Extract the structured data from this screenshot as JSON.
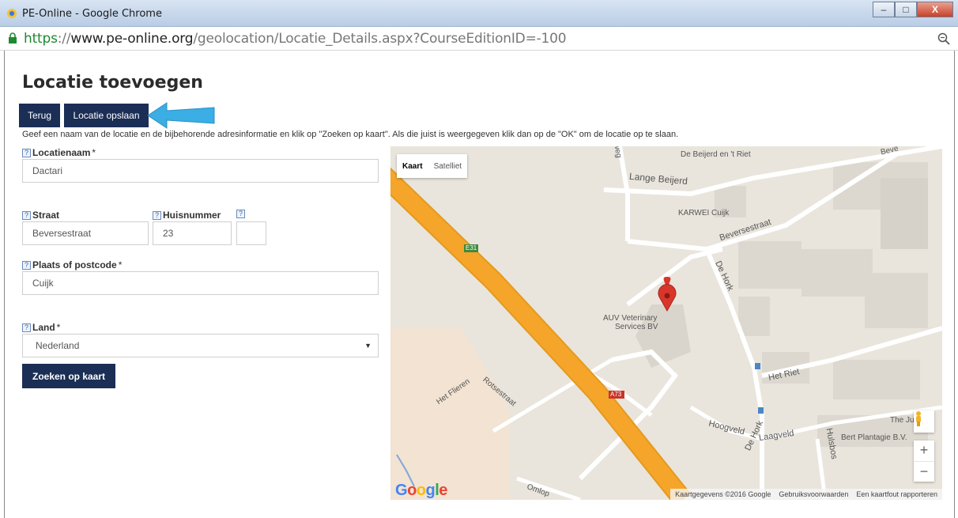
{
  "window": {
    "title": "PE-Online - Google Chrome",
    "controls": {
      "minimize": "–",
      "maximize": "□",
      "close": "X"
    }
  },
  "address": {
    "scheme": "https",
    "separator": "://",
    "host": "www.pe-online.org",
    "path": "/geolocation/Locatie_Details.aspx?CourseEditionID=-100"
  },
  "page": {
    "title": "Locatie toevoegen",
    "buttons": {
      "back": "Terug",
      "save": "Locatie opslaan",
      "search": "Zoeken op kaart"
    },
    "instruction": "Geef een naam van de locatie en de bijbehorende adresinformatie en klik op \"Zoeken op kaart\". Als die juist is weergegeven klik dan op de \"OK\" om de locatie op te slaan."
  },
  "form": {
    "help": "?",
    "required": "*",
    "locatienaam": {
      "label": "Locatienaam",
      "value": "Dactari"
    },
    "straat": {
      "label": "Straat",
      "value": "Beversestraat"
    },
    "huisnummer": {
      "label": "Huisnummer",
      "value": "23"
    },
    "toevoeging": {
      "value": ""
    },
    "plaats": {
      "label": "Plaats of postcode",
      "value": "Cuijk"
    },
    "land": {
      "label": "Land",
      "value": "Nederland"
    }
  },
  "map": {
    "type_buttons": {
      "map": "Kaart",
      "satellite": "Satelliet"
    },
    "labels": {
      "lange_beijerd": "Lange Beijerd",
      "beijerd_riet": "De Beijerd en 't Riet",
      "karwei": "KARWEI Cuijk",
      "beversestraat": "Beversestraat",
      "de_hork": "De Hork",
      "de_hork_2": "De Hork",
      "marker_line1": "AUV Veterinary",
      "marker_line2": "Services BV",
      "het_riet": "Het Riet",
      "het_flieren": "Het Flieren",
      "rotsestraat": "Rotsestraat",
      "hoogveld": "Hoogveld",
      "laagveld": "Laagveld",
      "hulsbos": "Hulsbos",
      "bert_plantagie": "Bert Plantagie B.V.",
      "the_ju": "The Ju",
      "omloop": "Omlop",
      "weg": "weg",
      "bev_top": "Beve",
      "e31": "E31",
      "a73": "A73"
    },
    "zoom": {
      "in": "+",
      "out": "−"
    },
    "google": [
      "G",
      "o",
      "o",
      "g",
      "l",
      "e"
    ],
    "footer": {
      "data": "Kaartgegevens ©2016 Google",
      "terms": "Gebruiksvoorwaarden",
      "report": "Een kaartfout rapporteren"
    },
    "colors": {
      "highway": "#f4a52a",
      "road": "#ffffff",
      "land": "#e9e5dc",
      "building": "#dcd8cf",
      "marker": "#d9362b"
    }
  },
  "colors": {
    "primary_button": "#1b2e55",
    "arrow": "#3aaee5"
  }
}
